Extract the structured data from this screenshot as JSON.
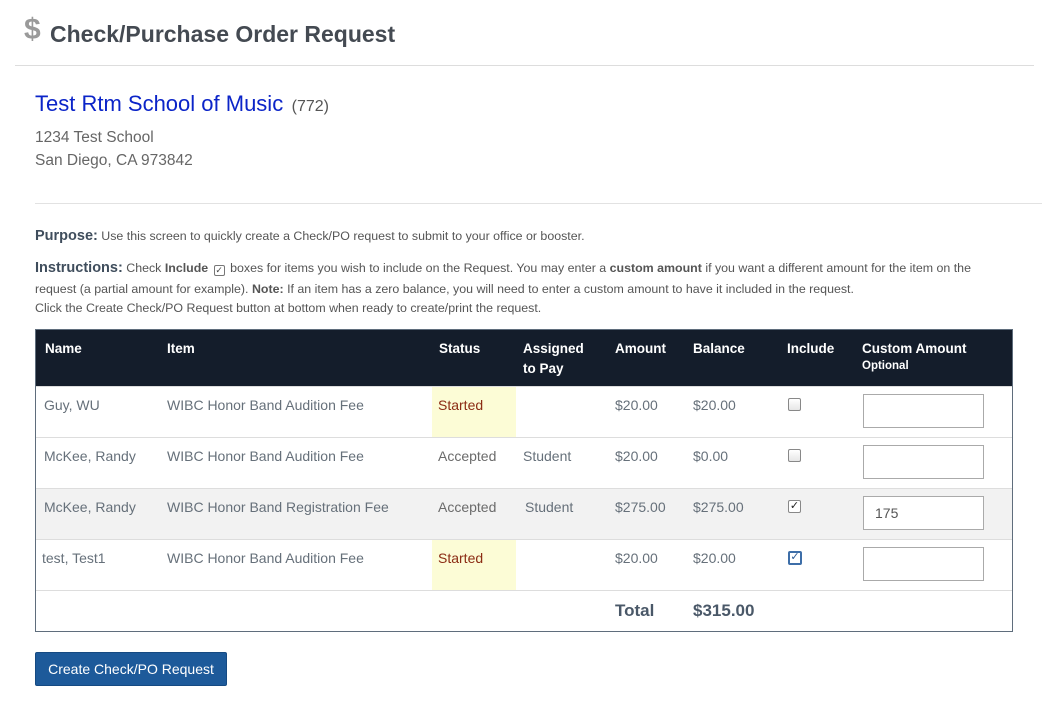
{
  "header": {
    "icon": "dollar-icon",
    "icon_glyph": "$",
    "title": "Check/Purchase Order Request"
  },
  "school": {
    "name": "Test Rtm School of Music",
    "id": "(772)",
    "address_line1": "1234 Test School",
    "address_line2": "San Diego, CA 973842"
  },
  "purpose": {
    "label": "Purpose:",
    "text": " Use this screen to quickly create a Check/PO request to submit to your office or booster."
  },
  "instructions": {
    "label": "Instructions:",
    "part1": " Check ",
    "include_word": "Include",
    "part2": " boxes for items you wish to include on the Request. You may enter a ",
    "custom_amount_word": "custom amount",
    "part3": " if you want a different amount for the item on the",
    "line2_part1": "request (a partial amount for example). ",
    "note_label": "Note:",
    "line2_part2": " If an item has a zero balance, you will need to enter a custom amount to have it included in the request.",
    "line3": "Click the Create Check/PO Request button at bottom when ready to create/print the request."
  },
  "table": {
    "headers": {
      "name": "Name",
      "item": "Item",
      "status": "Status",
      "assigned_line1": "Assigned",
      "assigned_line2": "to Pay",
      "amount": "Amount",
      "balance": "Balance",
      "include": "Include",
      "custom": "Custom Amount",
      "custom_sub": "Optional"
    },
    "rows": [
      {
        "name": "Guy, WU",
        "item": "WIBC Honor Band Audition Fee",
        "status": "Started",
        "assigned": "",
        "amount": "$20.00",
        "balance": "$20.00",
        "include": false,
        "custom": ""
      },
      {
        "name": "McKee, Randy",
        "item": "WIBC Honor Band Audition Fee",
        "status": "Accepted",
        "assigned": "Student",
        "amount": "$20.00",
        "balance": "$0.00",
        "include": false,
        "custom": ""
      },
      {
        "name": "McKee, Randy",
        "item": "WIBC Honor Band Registration Fee",
        "status": "Accepted",
        "assigned": "Student",
        "amount": "$275.00",
        "balance": "$275.00",
        "include": true,
        "custom": "175"
      },
      {
        "name": "test, Test1",
        "item": "WIBC Honor Band Audition Fee",
        "status": "Started",
        "assigned": "",
        "amount": "$20.00",
        "balance": "$20.00",
        "include": true,
        "custom": ""
      }
    ],
    "total_label": "Total",
    "total_value": "$315.00"
  },
  "actions": {
    "create_label": "Create Check/PO Request"
  },
  "colors": {
    "school_name": "#0b24c8",
    "table_header_bg": "#141d2b",
    "started_bg": "#fcfcd6",
    "started_text": "#8b2c14",
    "button_bg": "#1d5a9a"
  }
}
